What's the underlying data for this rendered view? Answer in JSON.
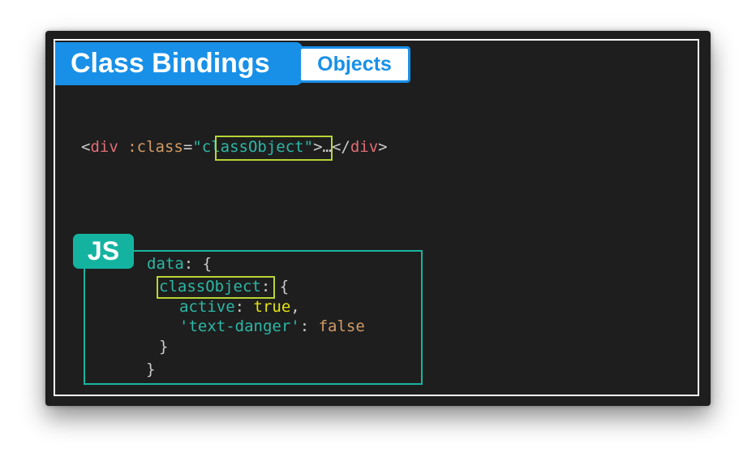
{
  "header": {
    "title": "Class Bindings",
    "subtitle": "Objects"
  },
  "template_line": {
    "open_lt": "<",
    "tag_open": "div",
    "space": " ",
    "attr": ":class",
    "eq": "=",
    "quote_open": "\"",
    "binding": "classObject",
    "quote_close": "\"",
    "mid": ">…</",
    "tag_close": "div",
    "close_gt": ">"
  },
  "js_badge": "JS",
  "js_code": {
    "line1_key": "data",
    "line1_punct": ": {",
    "line2_key": "classObject",
    "line2_punct": ": {",
    "line3_key": "active",
    "line3_punct": ": ",
    "line3_value": "true",
    "line3_comma": ",",
    "line4_key": "'text-danger'",
    "line4_punct": ": ",
    "line4_value": "false",
    "line5": "}",
    "line6": "}"
  },
  "colors": {
    "accent": "#1890e8",
    "js_accent": "#14b3a0",
    "highlight": "#b6d436",
    "background": "#1e1e1e"
  }
}
